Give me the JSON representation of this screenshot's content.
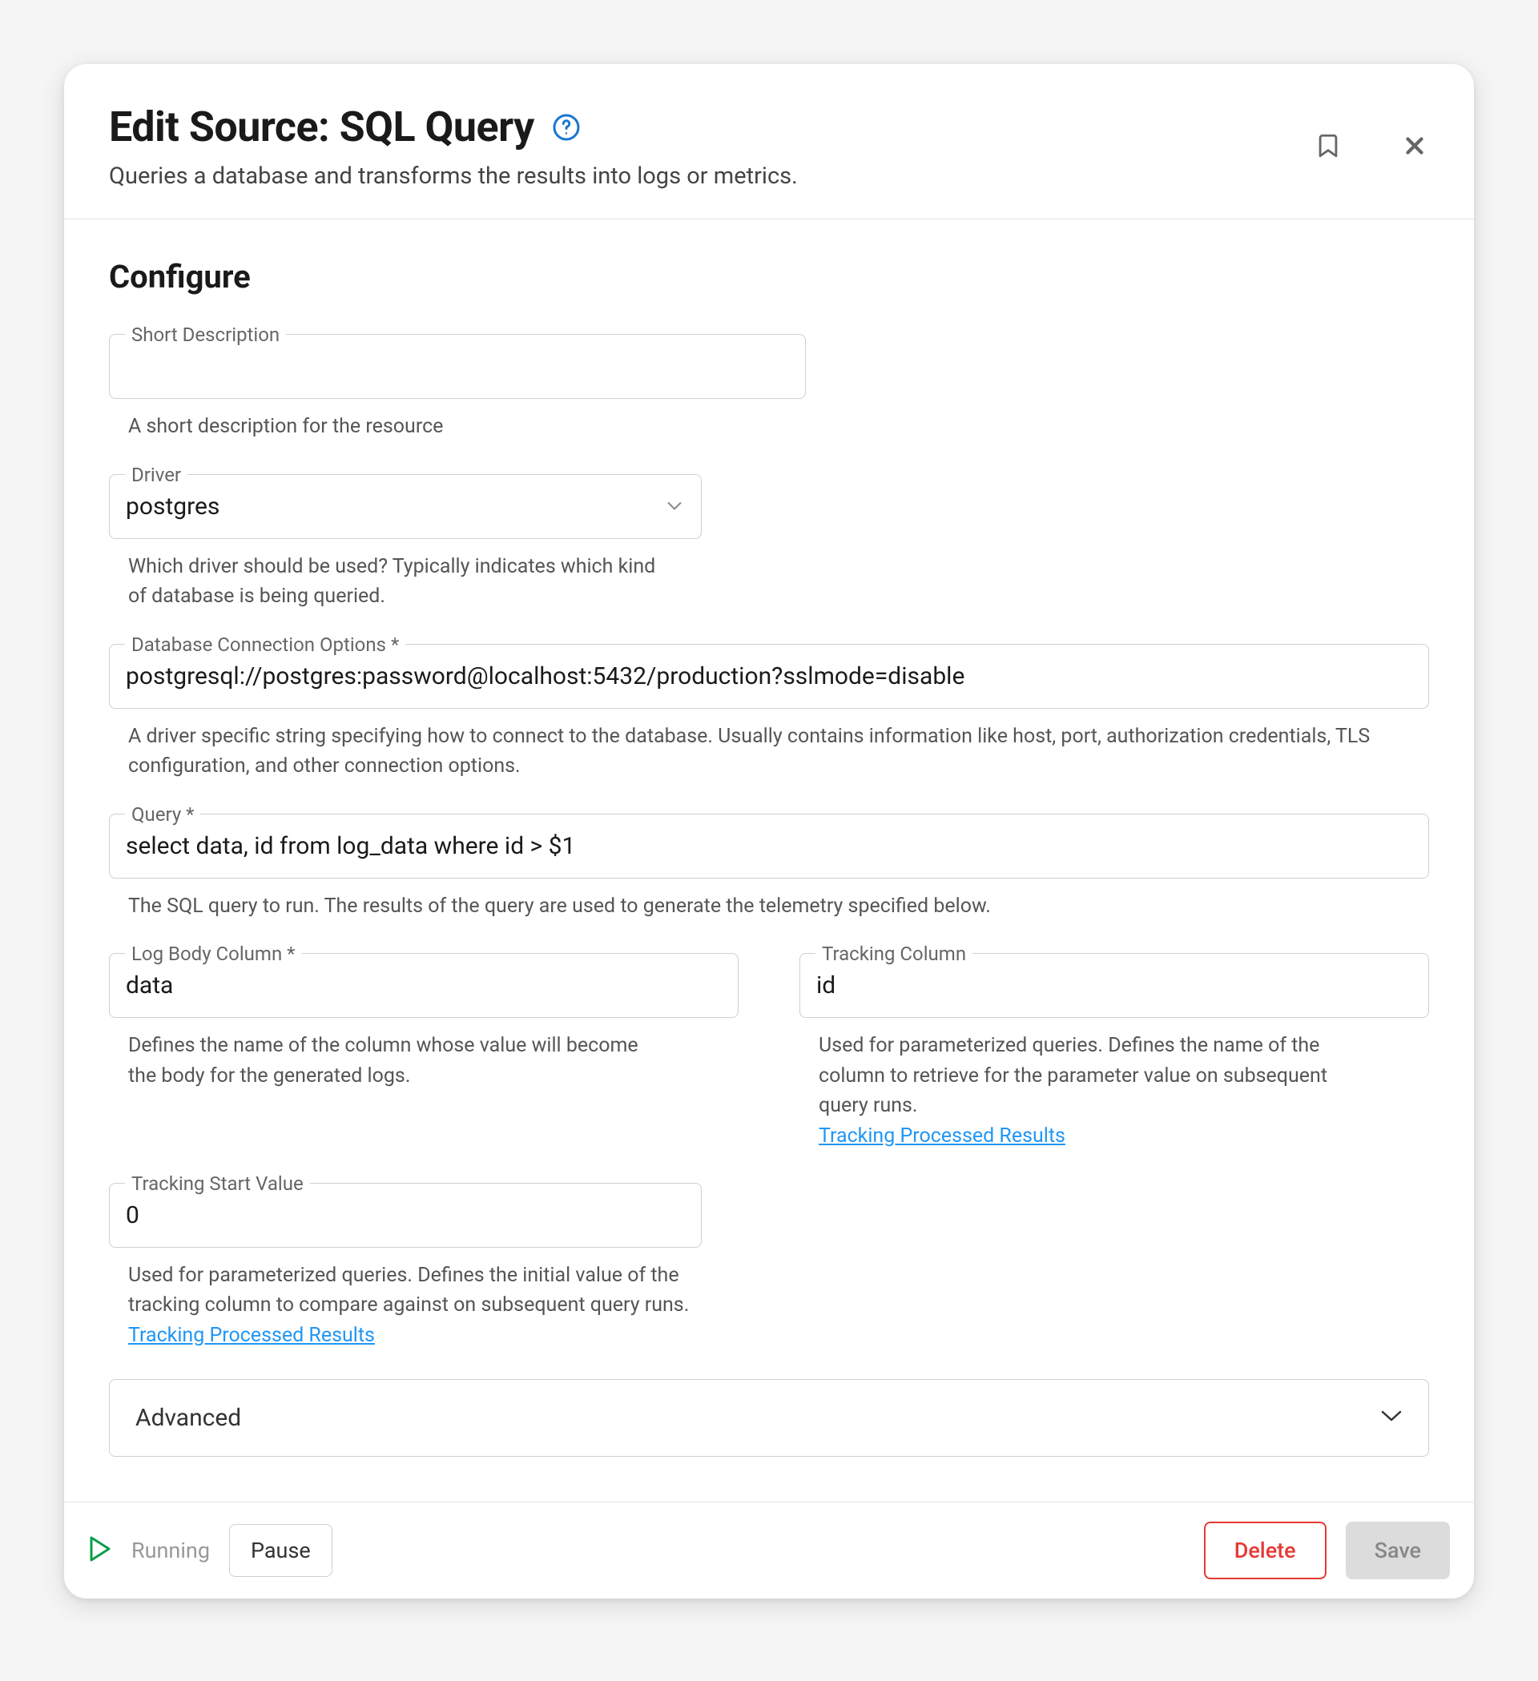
{
  "header": {
    "title": "Edit Source: SQL Query",
    "subtitle": "Queries a database and transforms the results into logs or metrics."
  },
  "section_title": "Configure",
  "fields": {
    "short_desc": {
      "label": "Short Description",
      "value": "",
      "help": "A short description for the resource"
    },
    "driver": {
      "label": "Driver",
      "value": "postgres",
      "help": "Which driver should be used? Typically indicates which kind of database is being queried."
    },
    "datasource": {
      "label": "Database Connection Options *",
      "value": "postgresql://postgres:password@localhost:5432/production?sslmode=disable",
      "help": "A driver specific string specifying how to connect to the database. Usually contains information like host, port, authorization credentials, TLS configuration, and other connection options."
    },
    "query": {
      "label": "Query *",
      "value": "select data, id from log_data where id > $1",
      "help": "The SQL query to run. The results of the query are used to generate the telemetry specified below."
    },
    "log_body": {
      "label": "Log Body Column *",
      "value": "data",
      "help": "Defines the name of the column whose value will become the body for the generated logs."
    },
    "tracking_column": {
      "label": "Tracking Column",
      "value": "id",
      "help": "Used for parameterized queries. Defines the name of the column to retrieve for the parameter value on subsequent query runs.",
      "link": "Tracking Processed Results"
    },
    "tracking_start": {
      "label": "Tracking Start Value",
      "value": "0",
      "help": "Used for parameterized queries. Defines the initial value of the tracking column to compare against on subsequent query runs.",
      "link": "Tracking Processed Results"
    }
  },
  "advanced_label": "Advanced",
  "footer": {
    "status": "Running",
    "pause": "Pause",
    "delete": "Delete",
    "save": "Save"
  }
}
